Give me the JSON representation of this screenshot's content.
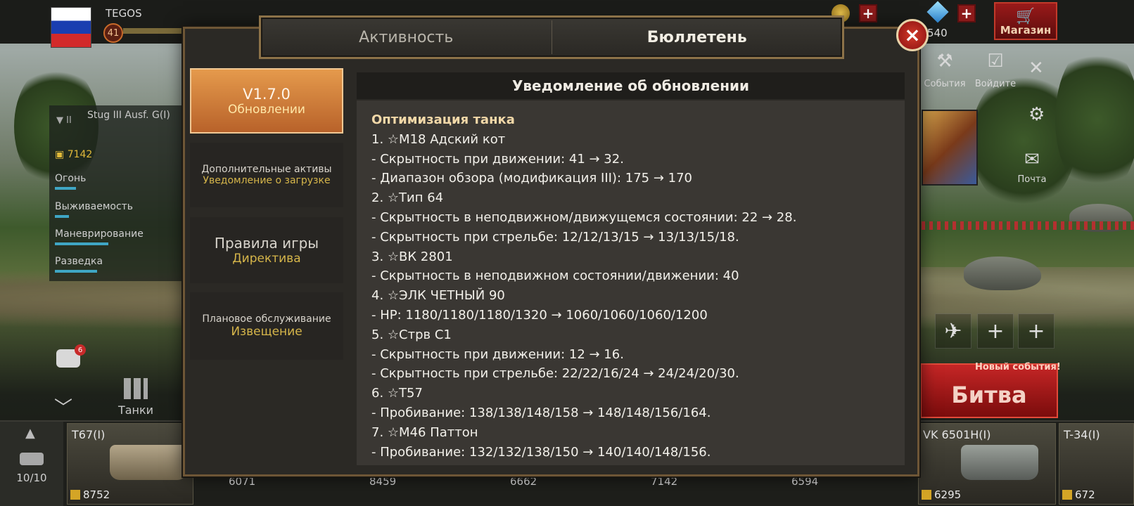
{
  "topbar": {
    "player_name": "TEGOS",
    "level": "41",
    "gems": "540",
    "shop_label": "Магазин",
    "plus_label": "+"
  },
  "tank_panel": {
    "tank_name": "Stug III Ausf. G(I)",
    "tier": "II",
    "rating": "7142",
    "stats": [
      {
        "label": "Огонь",
        "value": ""
      },
      {
        "label": "Выживаемость",
        "value": "1"
      },
      {
        "label": "Маневрирование",
        "value": "3"
      },
      {
        "label": "Разведка",
        "value": "2"
      }
    ]
  },
  "nav": {
    "chat_badge": "6",
    "tanks_label": "Танки",
    "garage_count": "10/10"
  },
  "garage": {
    "cards": [
      {
        "name": "T67(I)",
        "rating": "8752"
      },
      {
        "name": "VK 6501H(I)",
        "rating": "6295"
      },
      {
        "name": "T-34(I)",
        "rating": "672"
      }
    ],
    "strip_values": [
      "6071",
      "8459",
      "6662",
      "7142",
      "6594"
    ]
  },
  "right": {
    "icons": [
      {
        "label": "События"
      },
      {
        "label": "Войдите"
      },
      {
        "label": "Почта"
      }
    ],
    "battle_label": "Битва",
    "new_events_label": "Новый события!"
  },
  "modal": {
    "tabs": [
      {
        "label": "Активность",
        "active": false
      },
      {
        "label": "Бюллетень",
        "active": true
      }
    ],
    "close_label": "×",
    "sidebar": [
      {
        "title": "V1.7.0",
        "subtitle": "Обновлении",
        "selected": true
      },
      {
        "title": "Дополнительные активы",
        "subtitle": "Уведомление о загрузке",
        "selected": false
      },
      {
        "title": "Правила игры",
        "subtitle": "Директива",
        "selected": false
      },
      {
        "title": "Плановое обслуживание",
        "subtitle": "Извещение",
        "selected": false
      }
    ],
    "content": {
      "header": "Уведомление об обновлении",
      "section_title": "Оптимизация танка",
      "lines": [
        "1. ☆M18 Адский кот",
        "- Скрытность при движении: 41 → 32.",
        "- Диапазон обзора (модификация III): 175 → 170",
        "2. ☆Тип 64",
        "- Скрытность в неподвижном/движущемся состоянии: 22 → 28.",
        "- Скрытность при стрельбе: 12/12/13/15 → 13/13/15/18.",
        "3. ☆ВК 2801",
        "- Скрытность в неподвижном состоянии/движении: 40",
        "4. ☆ЭЛК ЧЕТНЫЙ 90",
        "- HP: 1180/1180/1180/1320 → 1060/1060/1060/1200",
        "5. ☆Стрв С1",
        "- Скрытность при движении: 12 → 16.",
        "- Скрытность при стрельбе: 22/22/16/24 → 24/24/20/30.",
        "6. ☆T57",
        "- Пробивание: 138/138/148/158 → 148/148/156/164.",
        "7. ☆M46 Паттон",
        "- Пробивание: 132/132/138/150 → 140/140/148/156."
      ]
    }
  }
}
